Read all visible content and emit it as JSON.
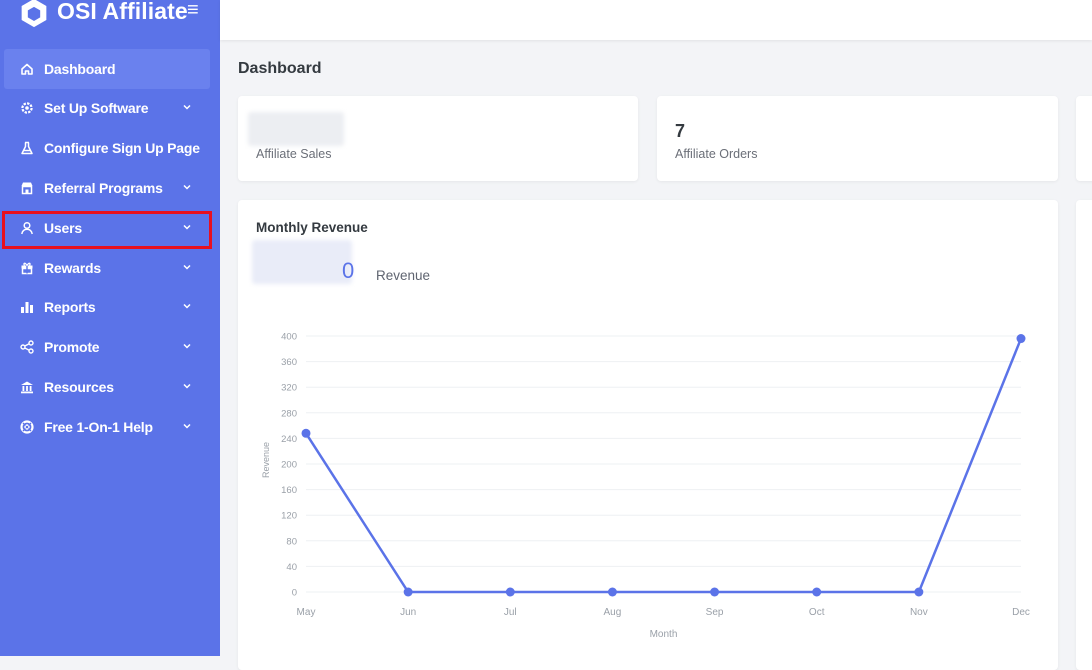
{
  "brand": {
    "name": "OSI Affiliate",
    "logo_icon": "hexagon-logo-icon",
    "menu_icon": "hamburger-icon"
  },
  "colors": {
    "sidebar": "#5b73e8",
    "accent": "#5b73e8",
    "highlight": "#e8101e"
  },
  "sidebar": {
    "items": [
      {
        "label": "Dashboard",
        "icon": "home-icon",
        "active": true,
        "has_submenu": false
      },
      {
        "label": "Set Up Software",
        "icon": "gear-icon",
        "has_submenu": true
      },
      {
        "label": "Configure Sign Up Page",
        "icon": "flask-icon",
        "has_submenu": false
      },
      {
        "label": "Referral Programs",
        "icon": "store-icon",
        "has_submenu": true
      },
      {
        "label": "Users",
        "icon": "user-icon",
        "has_submenu": true,
        "highlighted": true
      },
      {
        "label": "Rewards",
        "icon": "gift-icon",
        "has_submenu": true
      },
      {
        "label": "Reports",
        "icon": "bar-chart-icon",
        "has_submenu": true
      },
      {
        "label": "Promote",
        "icon": "share-icon",
        "has_submenu": true
      },
      {
        "label": "Resources",
        "icon": "bank-icon",
        "has_submenu": true
      },
      {
        "label": "Free 1-On-1 Help",
        "icon": "lifebuoy-icon",
        "has_submenu": true
      }
    ]
  },
  "main": {
    "page_title": "Dashboard",
    "stats": [
      {
        "label": "Affiliate Sales",
        "value": ""
      },
      {
        "label": "Affiliate Orders",
        "value": "7"
      }
    ],
    "revenue_card": {
      "title": "Monthly Revenue",
      "value_suffix": "0",
      "value_label": "Revenue"
    }
  },
  "chart_data": {
    "type": "line",
    "x": [
      "May",
      "Jun",
      "Jul",
      "Aug",
      "Sep",
      "Oct",
      "Nov",
      "Dec"
    ],
    "series": [
      {
        "values": [
          248,
          0,
          0,
          0,
          0,
          0,
          0,
          396
        ]
      }
    ],
    "xlabel": "Month",
    "ylabel": "Revenue",
    "ylim": [
      0,
      400
    ],
    "yticks": [
      0,
      40,
      80,
      120,
      160,
      200,
      240,
      280,
      320,
      360,
      400
    ],
    "grid": true,
    "color": "#5b73e8"
  }
}
